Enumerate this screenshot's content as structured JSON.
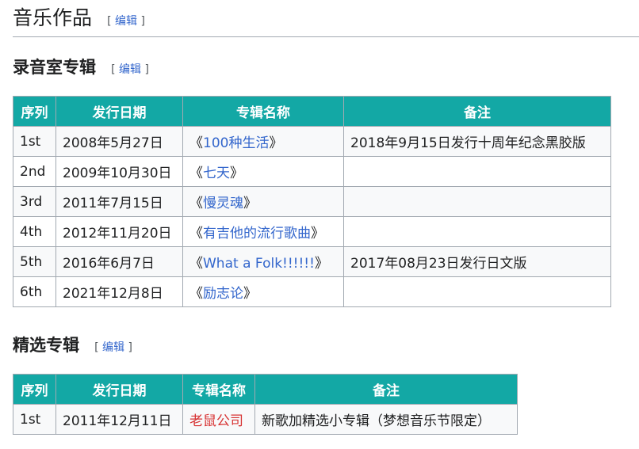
{
  "section": {
    "title": "音乐作品",
    "edit_label": "编辑",
    "bracket_open": "[",
    "bracket_close": "]"
  },
  "studio": {
    "title": "录音室专辑",
    "edit_label": "编辑",
    "headers": [
      "序列",
      "发行日期",
      "专辑名称",
      "备注"
    ],
    "rows": [
      {
        "seq": "1st",
        "date": "2008年5月27日",
        "open": "《",
        "album": "100种生活",
        "close": "》",
        "note": "2018年9月15日发行十周年纪念黑胶版"
      },
      {
        "seq": "2nd",
        "date": "2009年10月30日",
        "open": "《",
        "album": "七天",
        "close": "》",
        "note": ""
      },
      {
        "seq": "3rd",
        "date": "2011年7月15日",
        "open": "《",
        "album": "慢灵魂",
        "close": "》",
        "note": ""
      },
      {
        "seq": "4th",
        "date": "2012年11月20日",
        "open": "《",
        "album": "有吉他的流行歌曲",
        "close": "》",
        "note": ""
      },
      {
        "seq": "5th",
        "date": "2016年6月7日",
        "open": "《",
        "album": "What a Folk!!!!!!",
        "close": "》",
        "note": "2017年08月23日发行日文版"
      },
      {
        "seq": "6th",
        "date": "2021年12月8日",
        "open": "《",
        "album": "励志论",
        "close": "》",
        "note": ""
      }
    ]
  },
  "compilation": {
    "title": "精选专辑",
    "edit_label": "编辑",
    "headers": [
      "序列",
      "发行日期",
      "专辑名称",
      "备注"
    ],
    "rows": [
      {
        "seq": "1st",
        "date": "2011年12月11日",
        "album": "老鼠公司",
        "note": "新歌加精选小专辑（梦想音乐节限定）"
      }
    ]
  },
  "colors": {
    "header_bg": "#13a8a5",
    "link": "#3366cc",
    "redlink": "#d73333"
  }
}
